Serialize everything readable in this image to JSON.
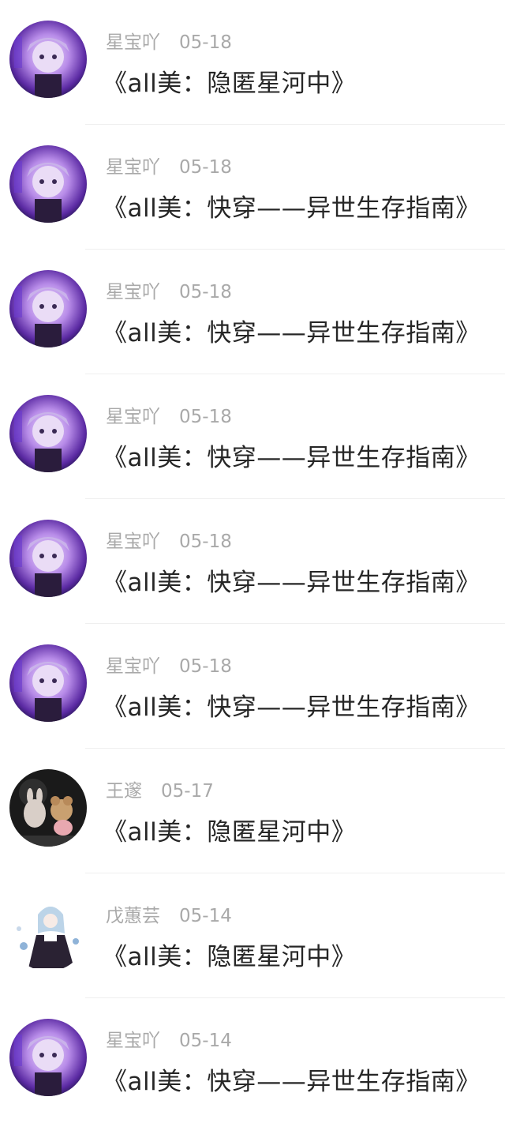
{
  "items": [
    {
      "author": "星宝吖",
      "date": "05-18",
      "title": "《all美：隐匿星河中》",
      "avatar": "purple-anime-avatar"
    },
    {
      "author": "星宝吖",
      "date": "05-18",
      "title": "《all美：快穿——异世生存指南》",
      "avatar": "purple-anime-avatar"
    },
    {
      "author": "星宝吖",
      "date": "05-18",
      "title": "《all美：快穿——异世生存指南》",
      "avatar": "purple-anime-avatar"
    },
    {
      "author": "星宝吖",
      "date": "05-18",
      "title": "《all美：快穿——异世生存指南》",
      "avatar": "purple-anime-avatar"
    },
    {
      "author": "星宝吖",
      "date": "05-18",
      "title": "《all美：快穿——异世生存指南》",
      "avatar": "purple-anime-avatar"
    },
    {
      "author": "星宝吖",
      "date": "05-18",
      "title": "《all美：快穿——异世生存指南》",
      "avatar": "purple-anime-avatar"
    },
    {
      "author": "王邃",
      "date": "05-17",
      "title": "《all美：隐匿星河中》",
      "avatar": "plush-toys-avatar"
    },
    {
      "author": "戊蕙芸",
      "date": "05-14",
      "title": "《all美：隐匿星河中》",
      "avatar": "chibi-girl-avatar"
    },
    {
      "author": "星宝吖",
      "date": "05-14",
      "title": "《all美：快穿——异世生存指南》",
      "avatar": "purple-anime-avatar"
    }
  ],
  "colors": {
    "meta_text": "#a9a9a9",
    "title_text": "#262626",
    "divider": "#efefef"
  }
}
